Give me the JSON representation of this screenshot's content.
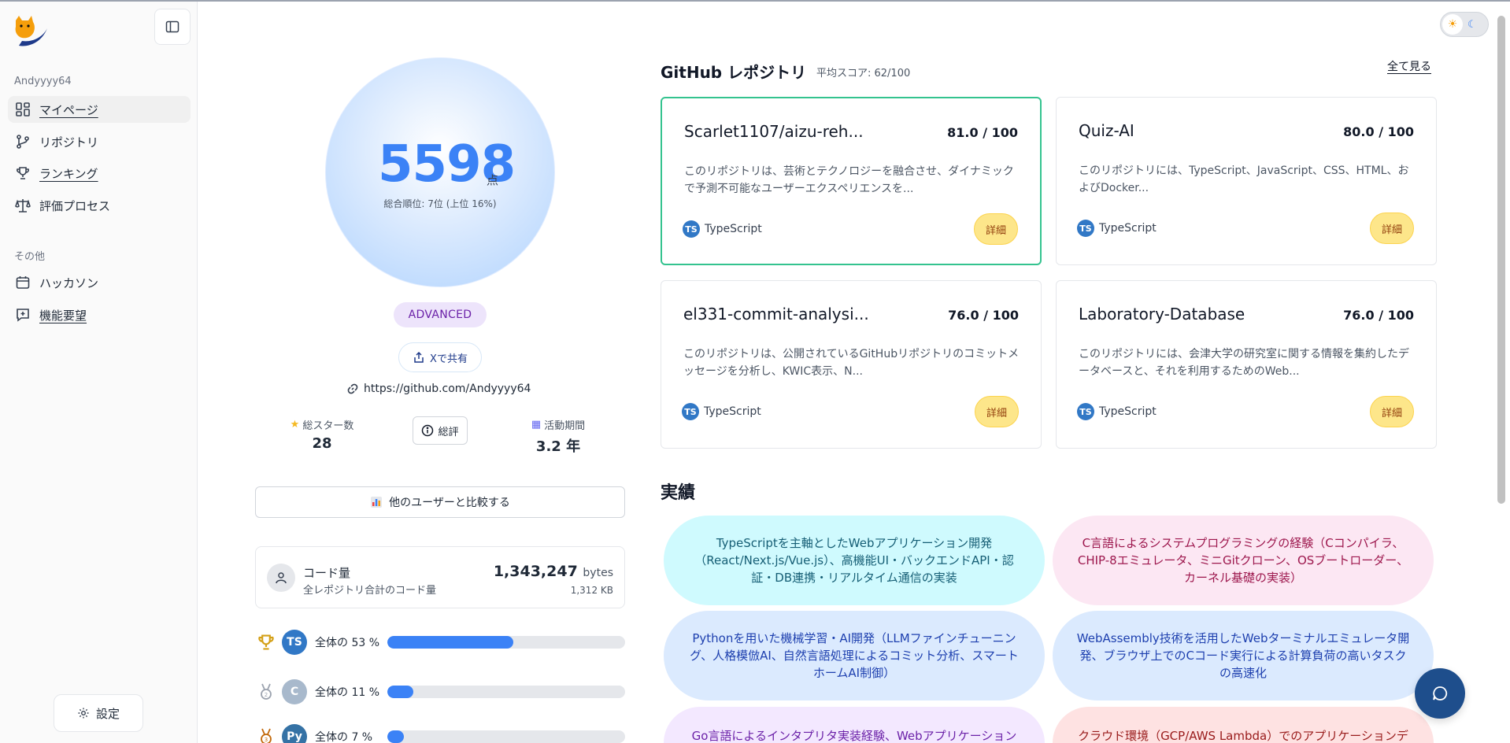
{
  "sidebar": {
    "username": "Andyyyy64",
    "nav": [
      {
        "label": "マイページ",
        "icon": "dashboard-icon"
      },
      {
        "label": "リポジトリ",
        "icon": "branch-icon"
      },
      {
        "label": "ランキング",
        "icon": "trophy-icon"
      },
      {
        "label": "評価プロセス",
        "icon": "scale-icon"
      }
    ],
    "other_label": "その他",
    "other": [
      {
        "label": "ハッカソン",
        "icon": "calendar-icon"
      },
      {
        "label": "機能要望",
        "icon": "feedback-icon"
      }
    ],
    "settings_label": "設定"
  },
  "profile": {
    "score": "5598",
    "score_unit": "点",
    "rank": "総合順位: 7位 (上位 16%)",
    "level": "ADVANCED",
    "share": "Xで共有",
    "github_url": "https://github.com/Andyyyy64",
    "stars_label": "総スター数",
    "stars_value": "28",
    "review_label": "総評",
    "period_label": "活動期間",
    "period_value": "3.2 年",
    "compare_label": "他のユーザーと比較する",
    "code": {
      "title": "コード量",
      "subtitle": "全レポジトリ合計のコード量",
      "bytes": "1,343,247",
      "bytes_unit": "bytes",
      "kb": "1,312 KB"
    },
    "languages": [
      {
        "name": "TypeScript",
        "abbr": "TS",
        "label": "全体の 53 %",
        "percent": 53,
        "color": "#3178c6"
      },
      {
        "name": "C",
        "abbr": "C",
        "label": "全体の 11 %",
        "percent": 11,
        "color": "#a8b9cc"
      },
      {
        "name": "Python",
        "abbr": "Py",
        "label": "全体の 7 %",
        "percent": 7,
        "color": "#3572a5"
      }
    ]
  },
  "repos": {
    "title": "GitHub レポジトリ",
    "avg": "平均スコア: 62/100",
    "see_all": "全て見る",
    "items": [
      {
        "name": "Scarlet1107/aizu-reh...",
        "score": "81.0 / 100",
        "desc": "このリポジトリは、芸術とテクノロジーを融合させ、ダイナミックで予測不可能なユーザーエクスペリエンスを...",
        "lang": "TypeScript",
        "detail": "詳細"
      },
      {
        "name": "Quiz-AI",
        "score": "80.0 / 100",
        "desc": "このリポジトリには、TypeScript、JavaScript、CSS、HTML、およびDocker...",
        "lang": "TypeScript",
        "detail": "詳細"
      },
      {
        "name": "el331-commit-analysi...",
        "score": "76.0 / 100",
        "desc": "このリポジトリは、公開されているGitHubリポジトリのコミットメッセージを分析し、KWIC表示、N...",
        "lang": "TypeScript",
        "detail": "詳細"
      },
      {
        "name": "Laboratory-Database",
        "score": "76.0 / 100",
        "desc": "このリポジトリには、会津大学の研究室に関する情報を集約したデータベースと、それを利用するためのWeb...",
        "lang": "TypeScript",
        "detail": "詳細"
      }
    ]
  },
  "achievements": {
    "title": "実績",
    "items": [
      "TypeScriptを主軸としたWebアプリケーション開発（React/Next.js/Vue.js）、高機能UI・バックエンドAPI・認証・DB連携・リアルタイム通信の実装",
      "C言語によるシステムプログラミングの経験（Cコンパイラ、CHIP-8エミュレータ、ミニGitクローン、OSブートローダー、カーネル基礎の実装）",
      "Pythonを用いた機械学習・AI開発（LLMファインチューニング、人格模倣AI、自然言語処理によるコミット分析、スマートホームAI制御）",
      "WebAssembly技術を活用したWebターミナルエミュレータ開発、ブラウザ上でのCコード実行による計算負荷の高いタスクの高速化",
      "Go言語によるインタプリタ実装経験、Webアプリケーション",
      "クラウド環境（GCP/AWS Lambda）でのアプリケーションデ"
    ]
  },
  "colors": {
    "accent": "#3b82f6",
    "highlight_border": "#34c38f",
    "detail_bg": "#fde68a"
  }
}
